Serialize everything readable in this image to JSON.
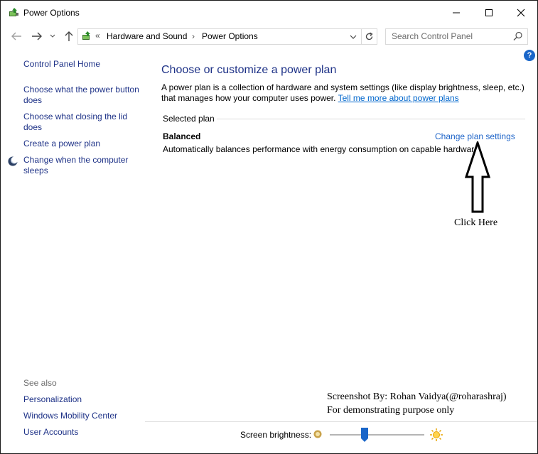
{
  "window": {
    "title": "Power Options",
    "controls": {
      "minimize": "minimize",
      "maximize": "maximize",
      "close": "close"
    }
  },
  "address_bar": {
    "overflow": "«",
    "breadcrumbs": [
      "Hardware and Sound",
      "Power Options"
    ],
    "separator": "›"
  },
  "search": {
    "placeholder": "Search Control Panel"
  },
  "help": {
    "label": "?"
  },
  "sidebar": {
    "home": "Control Panel Home",
    "links": [
      "Choose what the power button does",
      "Choose what closing the lid does",
      "Create a power plan",
      "Change when the computer sleeps"
    ],
    "see_also": {
      "heading": "See also",
      "links": [
        "Personalization",
        "Windows Mobility Center",
        "User Accounts"
      ]
    }
  },
  "main": {
    "title": "Choose or customize a power plan",
    "description": "A power plan is a collection of hardware and system settings (like display brightness, sleep, etc.) that manages how your computer uses power.",
    "learn_more_link": "Tell me more about power plans",
    "selected_plan_label": "Selected plan",
    "plan": {
      "name": "Balanced",
      "description": "Automatically balances performance with energy consumption on capable hardware.",
      "change_link": "Change plan settings"
    }
  },
  "annotation": {
    "click_here": "Click Here",
    "credit_line1": "Screenshot By: Rohan Vaidya(@roharashraj)",
    "credit_line2": "For demonstrating purpose only"
  },
  "footer": {
    "brightness_label": "Screen brightness:",
    "brightness_level": 0.37
  },
  "icons": {
    "app": "power-options-icon",
    "back": "back-arrow-icon",
    "forward": "forward-arrow-icon",
    "recent": "chevron-down-icon",
    "up": "up-arrow-icon",
    "refresh": "refresh-icon",
    "search": "search-icon",
    "sleep": "moon-icon",
    "dim": "dim-sun-icon",
    "bright": "bright-sun-icon"
  },
  "colors": {
    "link": "#1e3287",
    "accent": "#1e64c8",
    "slider_thumb": "#1a66c9"
  }
}
